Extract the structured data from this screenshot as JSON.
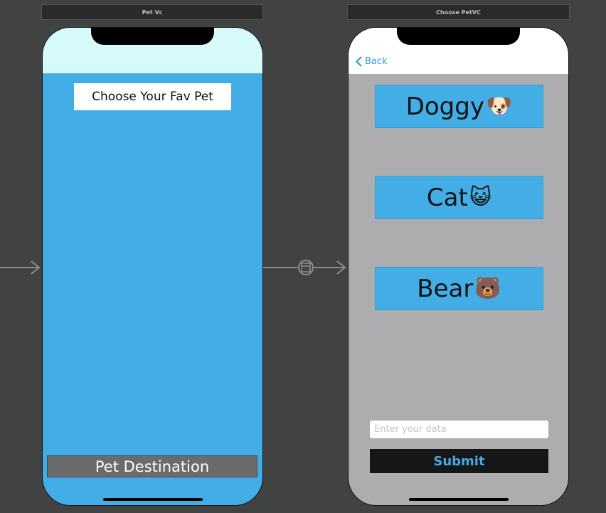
{
  "scene1": {
    "title": "Pet Vc",
    "choose_label": "Choose Your Fav Pet",
    "destination_button": "Pet Destination",
    "background_color": "#43aee6",
    "status_bar_color": "#d6f9fa"
  },
  "scene2": {
    "title": "Choose PetVC",
    "back_label": "Back",
    "pets": [
      {
        "label": "Doggy",
        "emoji": "🐶"
      },
      {
        "label": "Cat",
        "emoji": "😺"
      },
      {
        "label": "Bear",
        "emoji": "🐻"
      }
    ],
    "input_placeholder": "Enter your data",
    "input_value": "",
    "submit_label": "Submit",
    "background_color": "#adadb0",
    "accent_color": "#2d9de1"
  },
  "icons": {
    "back": "chevron-left-icon",
    "segue": "segue-modal-icon",
    "entry_arrow": "arrow-right-icon"
  }
}
